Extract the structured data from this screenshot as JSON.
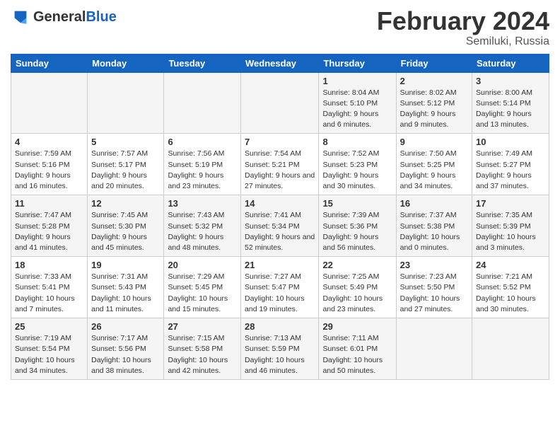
{
  "header": {
    "logo_general": "General",
    "logo_blue": "Blue",
    "title": "February 2024",
    "subtitle": "Semiluki, Russia"
  },
  "weekdays": [
    "Sunday",
    "Monday",
    "Tuesday",
    "Wednesday",
    "Thursday",
    "Friday",
    "Saturday"
  ],
  "weeks": [
    [
      {
        "day": "",
        "info": ""
      },
      {
        "day": "",
        "info": ""
      },
      {
        "day": "",
        "info": ""
      },
      {
        "day": "",
        "info": ""
      },
      {
        "day": "1",
        "info": "Sunrise: 8:04 AM\nSunset: 5:10 PM\nDaylight: 9 hours and 6 minutes."
      },
      {
        "day": "2",
        "info": "Sunrise: 8:02 AM\nSunset: 5:12 PM\nDaylight: 9 hours and 9 minutes."
      },
      {
        "day": "3",
        "info": "Sunrise: 8:00 AM\nSunset: 5:14 PM\nDaylight: 9 hours and 13 minutes."
      }
    ],
    [
      {
        "day": "4",
        "info": "Sunrise: 7:59 AM\nSunset: 5:16 PM\nDaylight: 9 hours and 16 minutes."
      },
      {
        "day": "5",
        "info": "Sunrise: 7:57 AM\nSunset: 5:17 PM\nDaylight: 9 hours and 20 minutes."
      },
      {
        "day": "6",
        "info": "Sunrise: 7:56 AM\nSunset: 5:19 PM\nDaylight: 9 hours and 23 minutes."
      },
      {
        "day": "7",
        "info": "Sunrise: 7:54 AM\nSunset: 5:21 PM\nDaylight: 9 hours and 27 minutes."
      },
      {
        "day": "8",
        "info": "Sunrise: 7:52 AM\nSunset: 5:23 PM\nDaylight: 9 hours and 30 minutes."
      },
      {
        "day": "9",
        "info": "Sunrise: 7:50 AM\nSunset: 5:25 PM\nDaylight: 9 hours and 34 minutes."
      },
      {
        "day": "10",
        "info": "Sunrise: 7:49 AM\nSunset: 5:27 PM\nDaylight: 9 hours and 37 minutes."
      }
    ],
    [
      {
        "day": "11",
        "info": "Sunrise: 7:47 AM\nSunset: 5:28 PM\nDaylight: 9 hours and 41 minutes."
      },
      {
        "day": "12",
        "info": "Sunrise: 7:45 AM\nSunset: 5:30 PM\nDaylight: 9 hours and 45 minutes."
      },
      {
        "day": "13",
        "info": "Sunrise: 7:43 AM\nSunset: 5:32 PM\nDaylight: 9 hours and 48 minutes."
      },
      {
        "day": "14",
        "info": "Sunrise: 7:41 AM\nSunset: 5:34 PM\nDaylight: 9 hours and 52 minutes."
      },
      {
        "day": "15",
        "info": "Sunrise: 7:39 AM\nSunset: 5:36 PM\nDaylight: 9 hours and 56 minutes."
      },
      {
        "day": "16",
        "info": "Sunrise: 7:37 AM\nSunset: 5:38 PM\nDaylight: 10 hours and 0 minutes."
      },
      {
        "day": "17",
        "info": "Sunrise: 7:35 AM\nSunset: 5:39 PM\nDaylight: 10 hours and 3 minutes."
      }
    ],
    [
      {
        "day": "18",
        "info": "Sunrise: 7:33 AM\nSunset: 5:41 PM\nDaylight: 10 hours and 7 minutes."
      },
      {
        "day": "19",
        "info": "Sunrise: 7:31 AM\nSunset: 5:43 PM\nDaylight: 10 hours and 11 minutes."
      },
      {
        "day": "20",
        "info": "Sunrise: 7:29 AM\nSunset: 5:45 PM\nDaylight: 10 hours and 15 minutes."
      },
      {
        "day": "21",
        "info": "Sunrise: 7:27 AM\nSunset: 5:47 PM\nDaylight: 10 hours and 19 minutes."
      },
      {
        "day": "22",
        "info": "Sunrise: 7:25 AM\nSunset: 5:49 PM\nDaylight: 10 hours and 23 minutes."
      },
      {
        "day": "23",
        "info": "Sunrise: 7:23 AM\nSunset: 5:50 PM\nDaylight: 10 hours and 27 minutes."
      },
      {
        "day": "24",
        "info": "Sunrise: 7:21 AM\nSunset: 5:52 PM\nDaylight: 10 hours and 30 minutes."
      }
    ],
    [
      {
        "day": "25",
        "info": "Sunrise: 7:19 AM\nSunset: 5:54 PM\nDaylight: 10 hours and 34 minutes."
      },
      {
        "day": "26",
        "info": "Sunrise: 7:17 AM\nSunset: 5:56 PM\nDaylight: 10 hours and 38 minutes."
      },
      {
        "day": "27",
        "info": "Sunrise: 7:15 AM\nSunset: 5:58 PM\nDaylight: 10 hours and 42 minutes."
      },
      {
        "day": "28",
        "info": "Sunrise: 7:13 AM\nSunset: 5:59 PM\nDaylight: 10 hours and 46 minutes."
      },
      {
        "day": "29",
        "info": "Sunrise: 7:11 AM\nSunset: 6:01 PM\nDaylight: 10 hours and 50 minutes."
      },
      {
        "day": "",
        "info": ""
      },
      {
        "day": "",
        "info": ""
      }
    ]
  ]
}
